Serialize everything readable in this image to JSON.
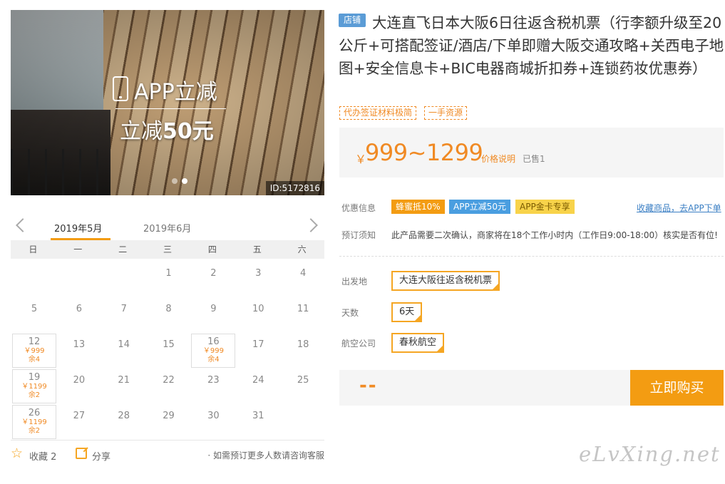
{
  "hero": {
    "app_line1": "APP立减",
    "app_line2_prefix": "立减",
    "app_line2_amount": "50元",
    "product_id": "ID:5172816"
  },
  "calendar": {
    "months": [
      "2019年5月",
      "2019年6月"
    ],
    "weekdays": [
      "日",
      "一",
      "二",
      "三",
      "四",
      "五",
      "六"
    ],
    "days": [
      {
        "day": "1"
      },
      {
        "day": "2"
      },
      {
        "day": "3"
      },
      {
        "day": "4"
      },
      {
        "day": "5"
      },
      {
        "day": "6"
      },
      {
        "day": "7"
      },
      {
        "day": "8"
      },
      {
        "day": "9"
      },
      {
        "day": "10"
      },
      {
        "day": "11"
      },
      {
        "day": "12",
        "price": "￥999",
        "remain": "余4"
      },
      {
        "day": "13"
      },
      {
        "day": "14"
      },
      {
        "day": "15"
      },
      {
        "day": "16",
        "price": "￥999",
        "remain": "余4"
      },
      {
        "day": "17"
      },
      {
        "day": "18"
      },
      {
        "day": "19",
        "price": "￥1199",
        "remain": "余2"
      },
      {
        "day": "20"
      },
      {
        "day": "21"
      },
      {
        "day": "22"
      },
      {
        "day": "23"
      },
      {
        "day": "24"
      },
      {
        "day": "25"
      },
      {
        "day": "26",
        "price": "￥1199",
        "remain": "余2"
      },
      {
        "day": "27"
      },
      {
        "day": "28"
      },
      {
        "day": "29"
      },
      {
        "day": "30"
      },
      {
        "day": "31"
      }
    ],
    "first_weekday": 3
  },
  "bottom": {
    "favorite_label": "收藏 2",
    "share_label": "分享",
    "consult_text": "· 如需预订更多人数请咨询客服"
  },
  "product": {
    "shop_badge": "店铺",
    "title": "大连直飞日本大阪6日往返含税机票（行李额升级至20公斤+可搭配签证/酒店/下单即赠大阪交通攻略+关西电子地图+安全信息卡+BIC电器商城折扣券+连锁药妆优惠券）",
    "tags": [
      "代办签证材料极简",
      "一手资源"
    ],
    "price_symbol": "￥",
    "price": "999~1299",
    "price_note": "价格说明",
    "sold": "已售1"
  },
  "promo": {
    "label": "优惠信息",
    "badges": [
      "蜂蜜抵10%",
      "APP立减50元",
      "APP金卡专享"
    ],
    "fav_link": "收藏商品，去APP下单"
  },
  "notice": {
    "label": "预订须知",
    "text": "此产品需要二次确认，商家将在18个工作小时内（工作日9:00-18:00）核实是否有位!"
  },
  "options": {
    "depart_label": "出发地",
    "depart_value": "大连大阪往返含税机票",
    "days_label": "天数",
    "days_value": "6天",
    "airline_label": "航空公司",
    "airline_value": "春秋航空"
  },
  "purchase": {
    "total": "--",
    "buy_label": "立即购买"
  },
  "watermark": "eLvXing.net",
  "colors": {
    "accent": "#f39c12",
    "price": "#f08a24",
    "blue_badge": "#4a9ee0",
    "link": "#3b7fc4"
  }
}
